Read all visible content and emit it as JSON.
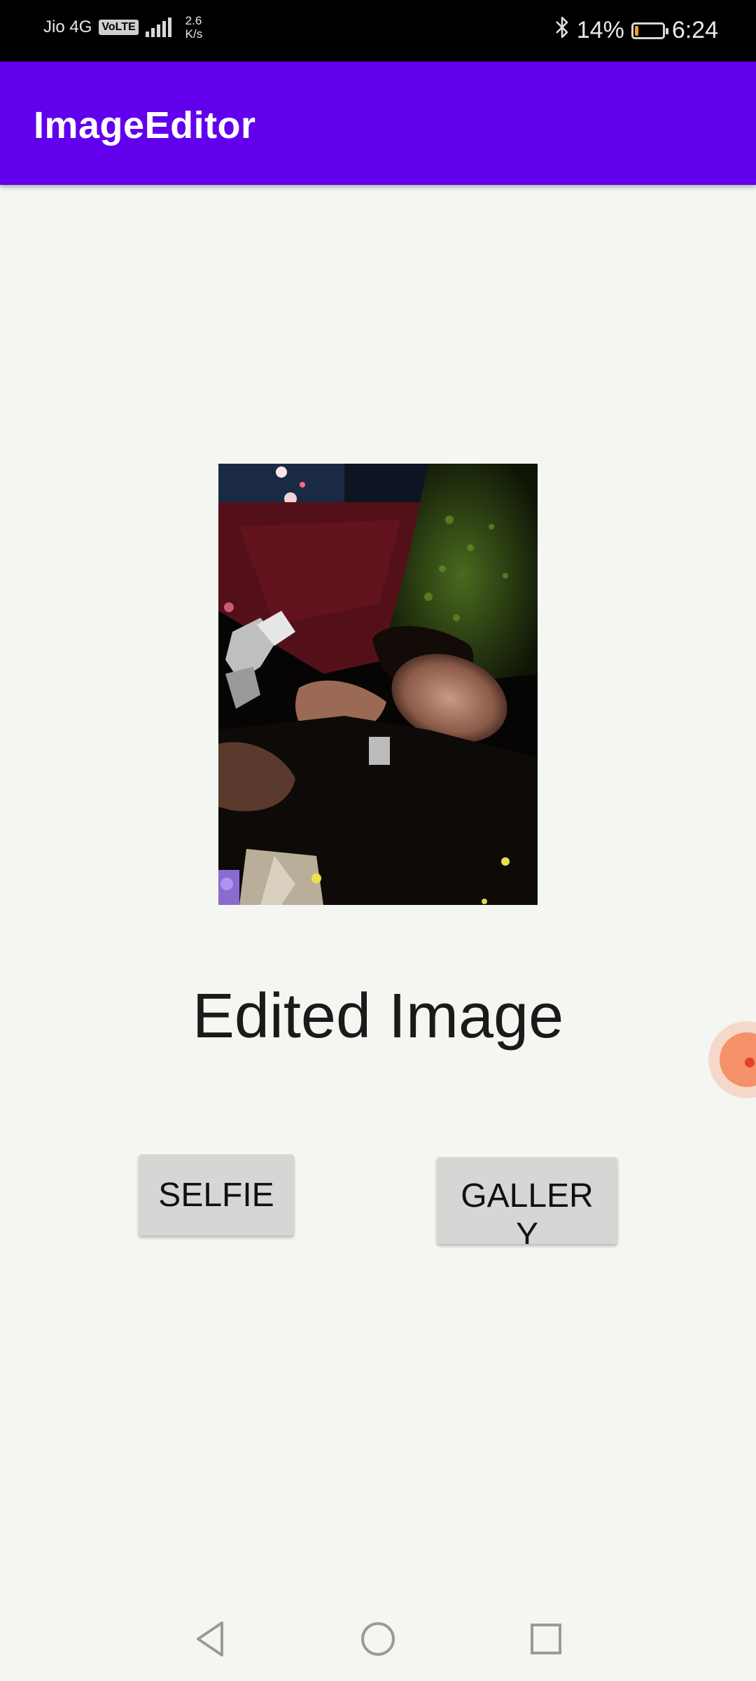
{
  "status_bar": {
    "carrier": "Jio 4G",
    "volte_badge": "VoLTE",
    "net_speed_value": "2.6",
    "net_speed_unit": "K/s",
    "battery_percent": "14%",
    "battery_level": 0.14,
    "time": "6:24",
    "icons": [
      "signal-icon",
      "bluetooth-icon",
      "battery-icon"
    ]
  },
  "app_bar": {
    "title": "ImageEditor",
    "color": "#6200ee"
  },
  "main": {
    "label": "Edited Image",
    "buttons": {
      "selfie": "SELFIE",
      "gallery": "GALLERY"
    }
  },
  "floating_bubble": {
    "icon": "floating-bubble-icon",
    "color": "#f49169"
  },
  "nav_bar": {
    "icons": [
      "back-icon",
      "home-icon",
      "recents-icon"
    ]
  }
}
